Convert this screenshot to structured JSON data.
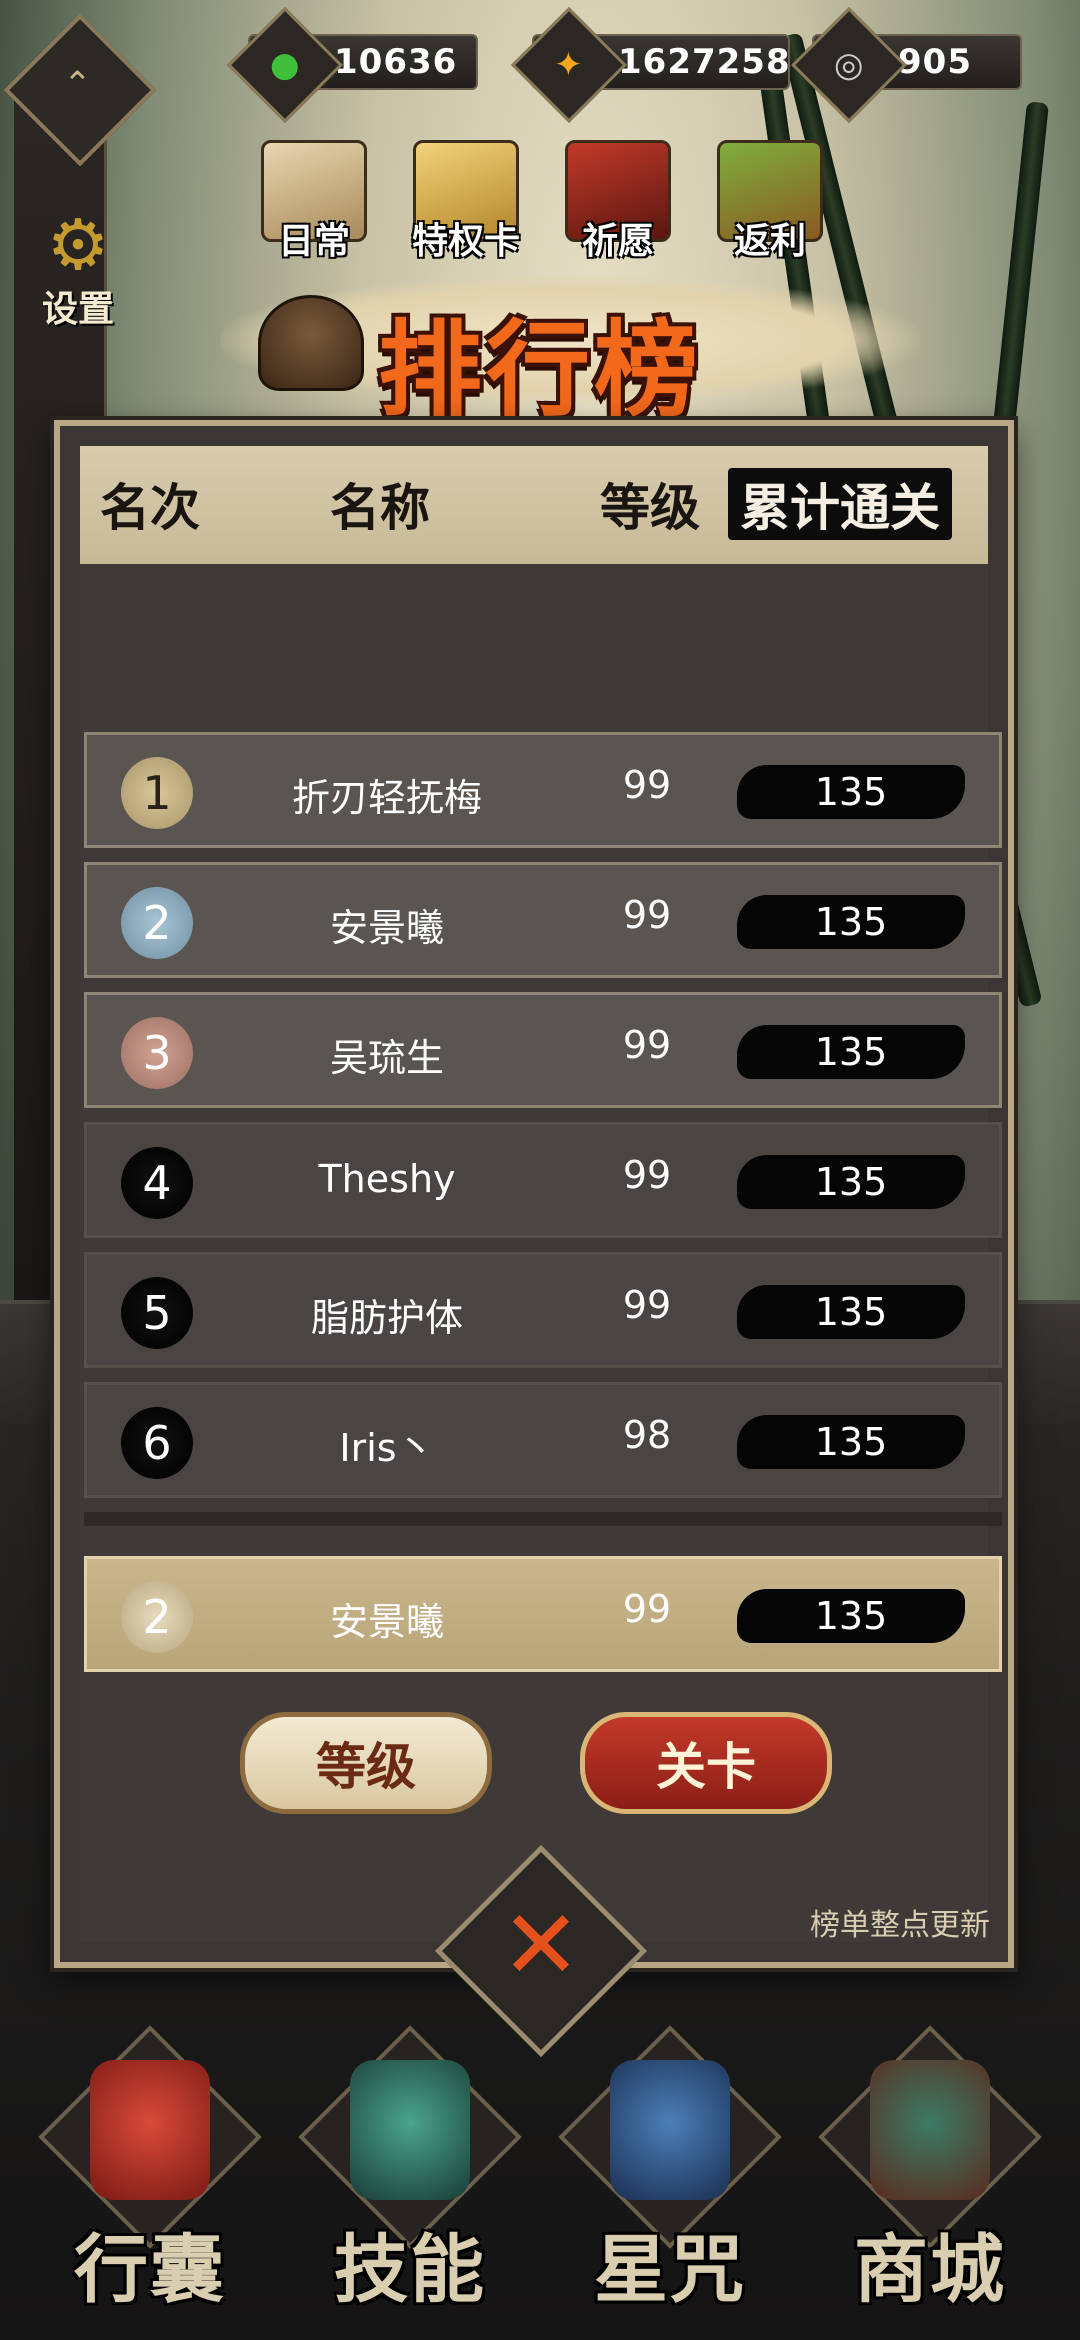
{
  "currencies": [
    {
      "icon": "jade-icon",
      "value": "10636",
      "color": "#3fbf3a"
    },
    {
      "icon": "gold-coin-icon",
      "value": "1627258",
      "color": "#f3a720"
    },
    {
      "icon": "silver-coin-icon",
      "value": "905",
      "color": "#c9c9c9"
    }
  ],
  "left_menu": {
    "settings_label": "设置"
  },
  "features": [
    {
      "label": "日常",
      "icon": "scroll-icon"
    },
    {
      "label": "特权卡",
      "icon": "privilege-card-icon"
    },
    {
      "label": "祈愿",
      "icon": "shrine-icon"
    },
    {
      "label": "返利",
      "icon": "treasure-chest-icon"
    }
  ],
  "leaderboard": {
    "title": "排行榜",
    "headers": {
      "rank": "名次",
      "name": "名称",
      "level": "等级",
      "stage": "累计通关"
    },
    "rows": [
      {
        "rank": "1",
        "name": "折刃轻抚梅",
        "level": "99",
        "stage": "135"
      },
      {
        "rank": "2",
        "name": "安景曦",
        "level": "99",
        "stage": "135"
      },
      {
        "rank": "3",
        "name": "吴琉生",
        "level": "99",
        "stage": "135"
      },
      {
        "rank": "4",
        "name": "Theshy",
        "level": "99",
        "stage": "135"
      },
      {
        "rank": "5",
        "name": "脂肪护体",
        "level": "99",
        "stage": "135"
      },
      {
        "rank": "6",
        "name": "Iris丶",
        "level": "98",
        "stage": "135"
      }
    ],
    "self_row": {
      "rank": "2",
      "name": "安景曦",
      "level": "99",
      "stage": "135"
    },
    "tab_level": "等级",
    "tab_stage": "关卡",
    "update_note": "榜单整点更新"
  },
  "bottom_nav": [
    {
      "label": "行囊",
      "icon": "bag-icon"
    },
    {
      "label": "技能",
      "icon": "skill-blade-icon"
    },
    {
      "label": "星咒",
      "icon": "star-scroll-icon"
    },
    {
      "label": "商城",
      "icon": "shop-icon"
    }
  ]
}
